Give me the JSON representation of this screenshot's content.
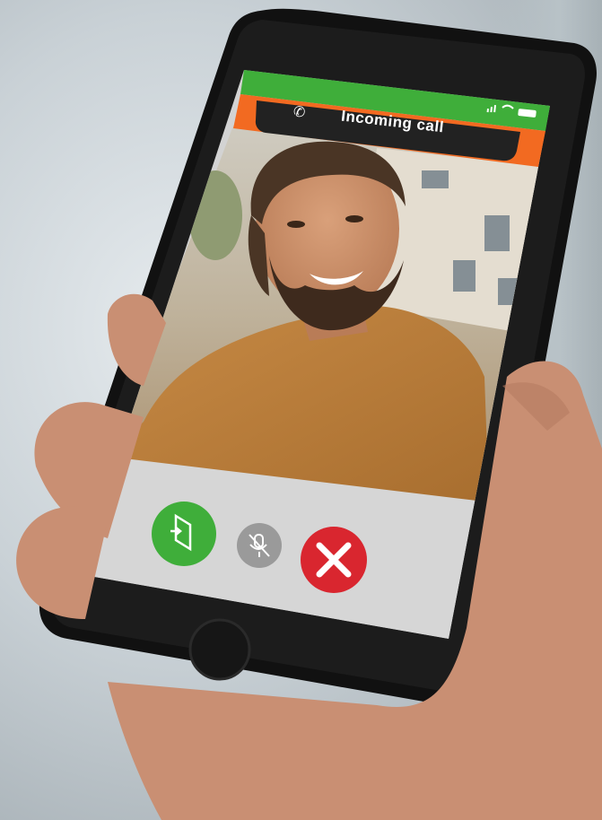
{
  "call_bar": {
    "title": "Incoming call",
    "phone_icon": "phone-icon"
  },
  "status": {
    "icons": [
      "signal-icon",
      "wifi-icon",
      "battery-icon"
    ]
  },
  "actions": [
    {
      "name": "open-door-button",
      "icon": "door-open-icon",
      "color": "#3fae3a"
    },
    {
      "name": "mute-button",
      "icon": "mic-muted-icon",
      "color": "#9a9a9a"
    },
    {
      "name": "reject-button",
      "icon": "close-icon",
      "color": "#d9262f"
    }
  ],
  "colors": {
    "status_green": "#3fae3a",
    "accent_orange": "#f26a21",
    "pill_dark": "#222222",
    "panel_gray": "#d4d4d4"
  }
}
